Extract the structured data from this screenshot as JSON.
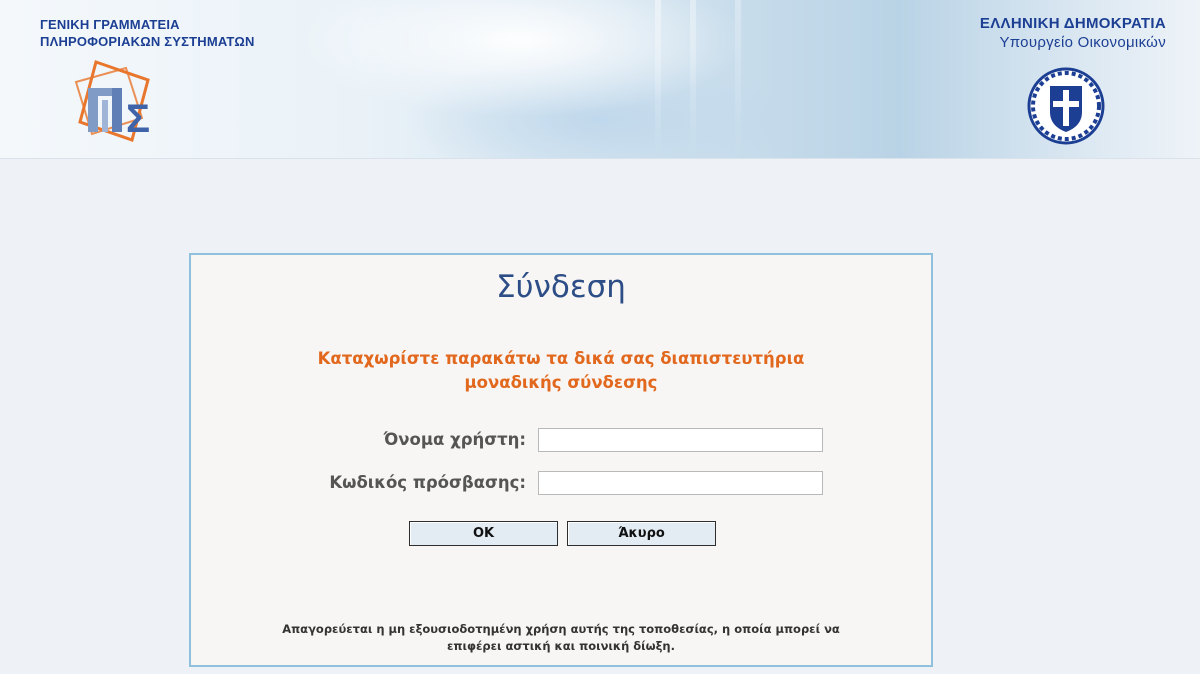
{
  "header": {
    "org_left_line1": "ΓΕΝΙΚΗ ΓΡΑΜΜΑΤΕΙΑ",
    "org_left_line2": "ΠΛΗΡΟΦΟΡΙΑΚΩΝ ΣΥΣΤΗΜΑΤΩΝ",
    "org_right_line1": "ΕΛΛΗΝΙΚΗ ΔΗΜΟΚΡΑΤΙΑ",
    "org_right_line2": "Υπουργείο Οικονομικών",
    "left_logo_icon": "gsis-logo-icon",
    "right_logo_icon": "greek-emblem-icon",
    "brand_color": "#1c3f94"
  },
  "login": {
    "title": "Σύνδεση",
    "instructions_line1": "Καταχωρίστε παρακάτω τα δικά σας διαπιστευτήρια",
    "instructions_line2": "μοναδικής σύνδεσης",
    "username_label": "Όνομα χρήστη:",
    "username_value": "",
    "password_label": "Κωδικός πρόσβασης:",
    "password_value": "",
    "ok_label": "OK",
    "cancel_label": "Άκυρο",
    "warning_line1": "Απαγορεύεται η μη εξουσιοδοτημένη χρήση αυτής της τοποθεσίας, η οποία μπορεί να",
    "warning_line2": "επιφέρει αστική και ποινική δίωξη.",
    "accent_color": "#e2681e",
    "title_color": "#2c4d86",
    "border_color": "#8fc0dc"
  }
}
